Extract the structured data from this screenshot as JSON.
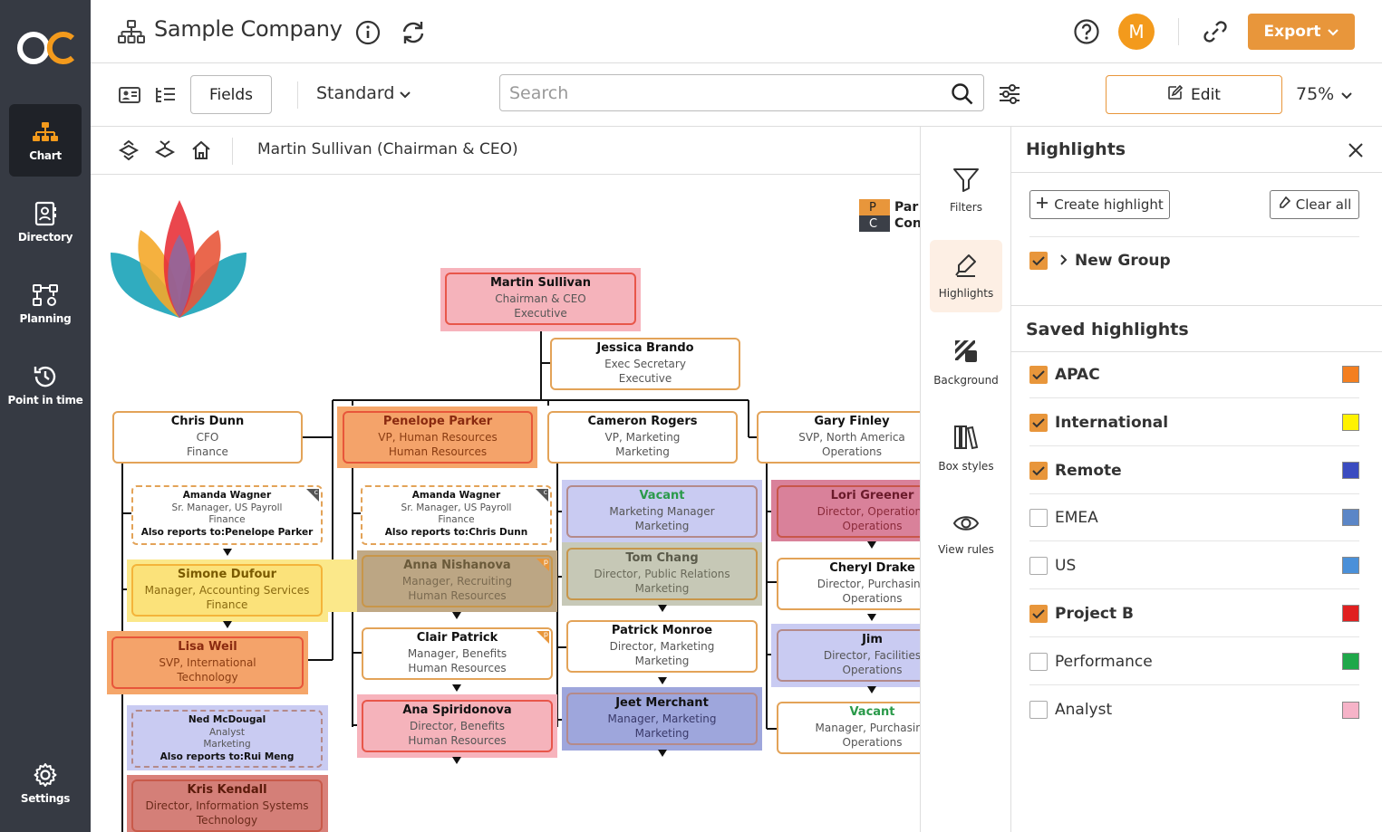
{
  "app": {
    "logo_text": "OC"
  },
  "sidebar": {
    "items": [
      {
        "label": "Chart",
        "icon": "org-chart-icon"
      },
      {
        "label": "Directory",
        "icon": "directory-icon"
      },
      {
        "label": "Planning",
        "icon": "planning-icon"
      },
      {
        "label": "Point in time",
        "icon": "history-icon"
      },
      {
        "label": "Settings",
        "icon": "gear-icon"
      }
    ]
  },
  "header": {
    "title": "Sample Company",
    "avatar_initial": "M",
    "export_label": "Export"
  },
  "toolbar": {
    "fields_label": "Fields",
    "view_label": "Standard",
    "search_placeholder": "Search",
    "edit_label": "Edit",
    "zoom": "75%"
  },
  "breadcrumb": {
    "current": "Martin Sullivan (Chairman & CEO)"
  },
  "legend": [
    {
      "key": "P",
      "label": "Par",
      "color": "#e8963b"
    },
    {
      "key": "C",
      "label": "Con",
      "color": "#3b3f47"
    }
  ],
  "org": {
    "martin": {
      "name": "Martin Sullivan",
      "title": "Chairman & CEO",
      "dept": "Executive"
    },
    "jessica": {
      "name": "Jessica Brando",
      "title": "Exec Secretary",
      "dept": "Executive"
    },
    "chris": {
      "name": "Chris  Dunn",
      "title": "CFO",
      "dept": "Finance"
    },
    "penelope": {
      "name": "Penelope Parker",
      "title": "VP, Human Resources",
      "dept": "Human Resources"
    },
    "cameron": {
      "name": "Cameron Rogers",
      "title": "VP, Marketing",
      "dept": "Marketing"
    },
    "gary": {
      "name": "Gary Finley",
      "title": "SVP, North America",
      "dept": "Operations"
    },
    "amanda1": {
      "name": "Amanda Wagner",
      "title": "Sr. Manager, US Payroll",
      "dept": "Finance",
      "also": "Also reports to:Penelope Parker"
    },
    "amanda2": {
      "name": "Amanda Wagner",
      "title": "Sr. Manager, US Payroll",
      "dept": "Finance",
      "also": "Also reports to:Chris  Dunn"
    },
    "simone": {
      "name": "Simone Dufour",
      "title": "Manager, Accounting Services",
      "dept": "Finance"
    },
    "lisa": {
      "name": "Lisa Weil",
      "title": "SVP, International",
      "dept": "Technology"
    },
    "ned": {
      "name": "Ned McDougal",
      "title": "Analyst",
      "dept": "Marketing",
      "also": "Also reports to:Rui Meng"
    },
    "kris": {
      "name": "Kris Kendall",
      "title": "Director, Information Systems",
      "dept": "Technology"
    },
    "anna": {
      "name": "Anna Nishanova",
      "title": "Manager, Recruiting",
      "dept": "Human Resources"
    },
    "clair": {
      "name": "Clair Patrick",
      "title": "Manager, Benefits",
      "dept": "Human Resources"
    },
    "ana": {
      "name": "Ana Spiridonova",
      "title": "Director, Benefits",
      "dept": "Human Resources"
    },
    "vacant1": {
      "name": "Vacant",
      "title": "Marketing Manager",
      "dept": "Marketing"
    },
    "tom": {
      "name": "Tom Chang",
      "title": "Director, Public Relations",
      "dept": "Marketing"
    },
    "patrick": {
      "name": "Patrick Monroe",
      "title": "Director, Marketing",
      "dept": "Marketing"
    },
    "jeet": {
      "name": "Jeet Merchant",
      "title": "Manager, Marketing",
      "dept": "Marketing"
    },
    "lori": {
      "name": "Lori Greener",
      "title": "Director, Operations",
      "dept": "Operations"
    },
    "cheryl": {
      "name": "Cheryl Drake",
      "title": "Director, Purchasing",
      "dept": "Operations"
    },
    "jim": {
      "name": "Jim",
      "title": "Director, Facilities",
      "dept": "Operations"
    },
    "vacant2": {
      "name": "Vacant",
      "title": "Manager, Purchasing",
      "dept": "Operations"
    }
  },
  "rail": {
    "items": [
      {
        "label": "Filters",
        "icon": "filter-icon"
      },
      {
        "label": "Highlights",
        "icon": "highlighter-icon"
      },
      {
        "label": "Background",
        "icon": "background-icon"
      },
      {
        "label": "Box styles",
        "icon": "box-styles-icon"
      },
      {
        "label": "View rules",
        "icon": "eye-icon"
      }
    ]
  },
  "highlights": {
    "title": "Highlights",
    "create_label": "Create highlight",
    "clear_label": "Clear all",
    "group_label": "New Group",
    "group_checked": true,
    "saved_title": "Saved highlights",
    "items": [
      {
        "name": "APAC",
        "checked": true,
        "color": "#f47f20"
      },
      {
        "name": "International",
        "checked": true,
        "color": "#fff200"
      },
      {
        "name": "Remote",
        "checked": true,
        "color": "#3b4cc0"
      },
      {
        "name": "EMEA",
        "checked": false,
        "color": "#5b86c7"
      },
      {
        "name": "US",
        "checked": false,
        "color": "#4a90d9"
      },
      {
        "name": "Project B",
        "checked": true,
        "color": "#e02020"
      },
      {
        "name": "Performance",
        "checked": false,
        "color": "#1fa84a"
      },
      {
        "name": "Analyst",
        "checked": false,
        "color": "#f6b3c8"
      }
    ]
  }
}
